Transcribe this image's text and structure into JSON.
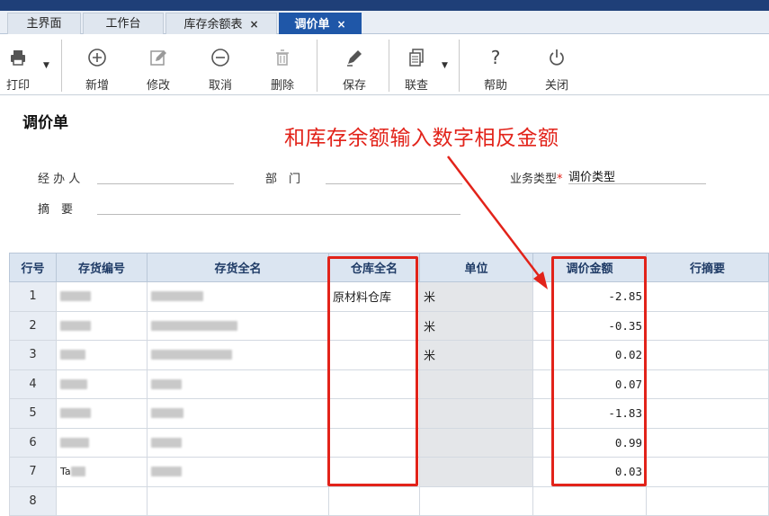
{
  "tabs": [
    {
      "label": "主界面"
    },
    {
      "label": "工作台"
    },
    {
      "label": "库存余额表",
      "close": "×"
    },
    {
      "label": "调价单",
      "close": "×"
    }
  ],
  "toolbar": {
    "print": "打印",
    "add": "新增",
    "edit": "修改",
    "cancel": "取消",
    "delete": "删除",
    "save": "保存",
    "link": "联查",
    "help": "帮助",
    "close": "关闭"
  },
  "form": {
    "title": "调价单",
    "handler_label": "经 办 人",
    "dept_label": "部　门",
    "biztype_label": "业务类型",
    "biztype_required": "*",
    "biztype_value": "调价类型",
    "summary_label": "摘　要"
  },
  "annotation": "和库存余额输入数字相反金额",
  "table": {
    "headers": [
      "行号",
      "存货编号",
      "存货全名",
      "仓库全名",
      "单位",
      "调价金额",
      "行摘要"
    ],
    "rows": [
      {
        "no": "1",
        "warehouse": "原材料仓库",
        "unit": "米",
        "amount": "-2.85"
      },
      {
        "no": "2",
        "warehouse": "",
        "unit": "米",
        "amount": "-0.35"
      },
      {
        "no": "3",
        "warehouse": "",
        "unit": "米",
        "amount": "0.02"
      },
      {
        "no": "4",
        "warehouse": "",
        "unit": "",
        "amount": "0.07"
      },
      {
        "no": "5",
        "warehouse": "",
        "unit": "",
        "amount": "-1.83"
      },
      {
        "no": "6",
        "warehouse": "",
        "unit": "",
        "amount": "0.99"
      },
      {
        "no": "7",
        "warehouse": "",
        "unit": "",
        "amount": "0.03",
        "code_prefix": "Ta"
      },
      {
        "no": "8",
        "warehouse": "",
        "unit": "",
        "amount": ""
      }
    ]
  },
  "colors": {
    "accent": "#1f57a8",
    "annotation": "#e2231a",
    "header_bg": "#dbe5f1"
  }
}
